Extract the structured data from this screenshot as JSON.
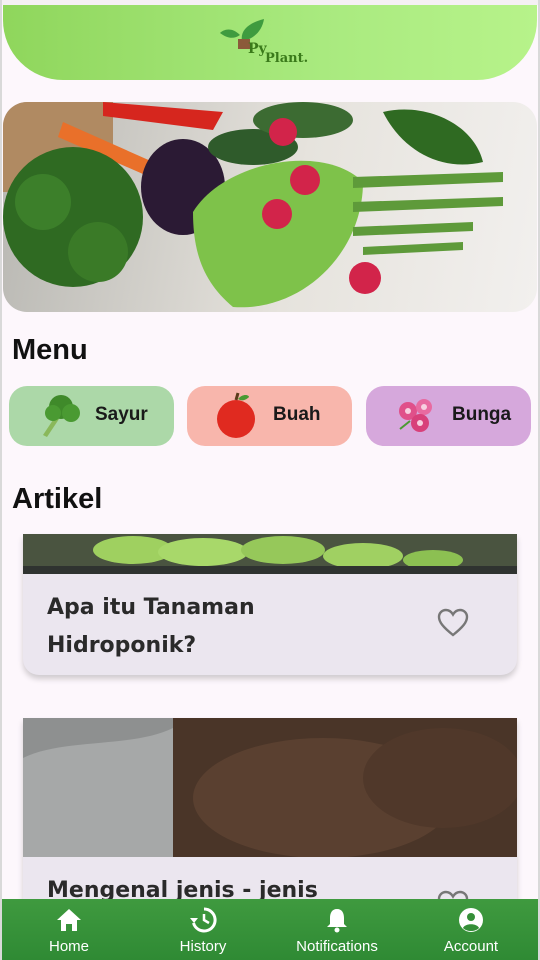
{
  "app": {
    "logo_py": "Py",
    "logo_plant": "Plant."
  },
  "sections": {
    "menu_title": "Menu",
    "article_title": "Artikel"
  },
  "menu": [
    {
      "label": "Sayur",
      "icon": "broccoli-icon",
      "color": "#acd8a8"
    },
    {
      "label": "Buah",
      "icon": "apple-icon",
      "color": "#f8b6ac"
    },
    {
      "label": "Bunga",
      "icon": "flower-icon",
      "color": "#d6a8dc"
    }
  ],
  "articles": [
    {
      "title": "Apa itu Tanaman Hidroponik?"
    },
    {
      "title": "Mengenal jenis - jenis"
    }
  ],
  "bottom_nav": [
    {
      "label": "Home",
      "icon": "home-icon"
    },
    {
      "label": "History",
      "icon": "history-icon"
    },
    {
      "label": "Notifications",
      "icon": "bell-icon"
    },
    {
      "label": "Account",
      "icon": "account-icon"
    }
  ],
  "colors": {
    "header": "#a9ea7f",
    "nav": "#3a943a",
    "card": "#ebe6ef"
  }
}
